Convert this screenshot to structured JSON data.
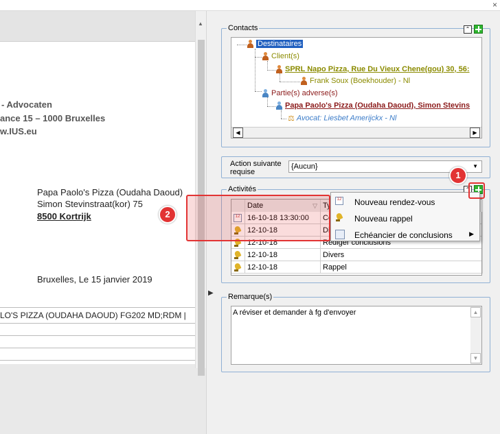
{
  "window": {
    "close_glyph": "×"
  },
  "document": {
    "firm_line1": "- Advocaten",
    "firm_line2": "ance 15 – 1000 Bruxelles",
    "firm_line3": "w.IUS.eu",
    "recipient_name": "Papa Paolo's Pizza (Oudaha Daoud)",
    "recipient_street": "Simon Stevinstraat(kor) 75",
    "recipient_city": "8500 Kortrijk",
    "date_line": "Bruxelles, Le 15 janvier 2019",
    "reference_line": "LO'S PIZZA (OUDAHA DAOUD) FG202 MD;RDM |"
  },
  "contacts": {
    "label": "Contacts",
    "tree": [
      {
        "text": "Destinataires",
        "icon": "group-icon",
        "selected": true
      },
      {
        "text": "Client(s)",
        "icon": "person-icon"
      },
      {
        "text": "SPRL Napo Pizza, Rue Du Vieux Chene(gou) 30, 56:",
        "icon": "person-icon"
      },
      {
        "text": "Frank Soux (Boekhouder) - Nl",
        "icon": "person-icon"
      },
      {
        "text": "Partie(s) adverse(s)",
        "icon": "person-blue-icon"
      },
      {
        "text": "Papa Paolo's Pizza (Oudaha Daoud), Simon Stevins",
        "icon": "person-blue-icon"
      },
      {
        "text": "Avocat: Liesbet Amerijckx - Nl",
        "icon": "scales-icon"
      }
    ],
    "colors": {
      "client": "#8b8b00",
      "adverse": "#8b1a1a",
      "lawyer": "#3a7bc8",
      "selected_bg": "#1f5fbf"
    }
  },
  "action_suivante": {
    "label": "Action suivante requise",
    "value": "{Aucun}"
  },
  "activites": {
    "label": "Activités",
    "columns": [
      "",
      "Date",
      "Ty"
    ],
    "rows": [
      {
        "icon": "calendar-icon",
        "date": "16-10-18 13:30:00",
        "type": "Co"
      },
      {
        "icon": "bell-icon",
        "date": "12-10-18",
        "type": "Di"
      },
      {
        "icon": "bell-icon",
        "date": "12-10-18",
        "type": "Rédiger conclusions"
      },
      {
        "icon": "bell-icon",
        "date": "12-10-18",
        "type": "Divers"
      },
      {
        "icon": "bell-icon",
        "date": "12-10-18",
        "type": "Rappel"
      }
    ]
  },
  "context_menu": {
    "items": [
      {
        "label": "Nouveau rendez-vous",
        "icon": "calendar-icon"
      },
      {
        "label": "Nouveau rappel",
        "icon": "bell-icon"
      },
      {
        "label": "Echéancier de conclusions",
        "icon": "schedule-icon",
        "has_submenu": true
      }
    ]
  },
  "remarque": {
    "label": "Remarque(s)",
    "text": "A réviser et demander à fg d'envoyer"
  },
  "callouts": {
    "one": "1",
    "two": "2",
    "color": "#e23333"
  }
}
